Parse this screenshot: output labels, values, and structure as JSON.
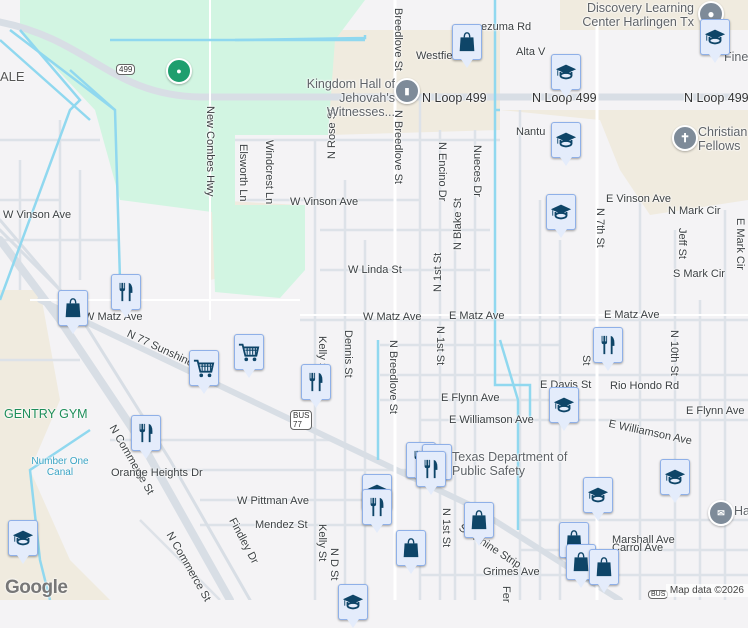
{
  "map": {
    "colors": {
      "background": "#f4f3f5",
      "park": "#d2f5e2",
      "land": "#f0ebdf",
      "road": "#d8dee5",
      "water": "#90d8ef",
      "marker": "#0e4568"
    },
    "roads": {
      "n_loop_499": "N Loop 499",
      "route_499": "499",
      "new_combes_hwy": "New Combes Hwy",
      "breedlove_st": "Breedlove St",
      "n_breedlove_st": "N Breedlove St",
      "n_breedlove_st_2": "N Breedlove St",
      "montezuma_rd": "ezuma Rd",
      "westfield": "Westfie",
      "alta_vista": "Alta V",
      "nantucket": "Nantu",
      "n_rose_st": "N Rose St",
      "elsworth_ln": "Elsworth Ln",
      "windcrest_ln": "Windcrest Ln",
      "n_encino_dr": "N Encino Dr",
      "nueces_dr": "Nueces Dr",
      "n_blake_st": "N Blake St",
      "n_1st_st": "N 1st St",
      "n_1st_st_2": "N 1st St",
      "n_1st_st_3": "N 1st St",
      "w_vinson_ave": "W Vinson Ave",
      "w_vinson_ave_2": "W Vinson Ave",
      "e_vinson_ave": "E Vinson Ave",
      "n_7th_st": "N 7th St",
      "n_7th_st_2": "St",
      "n_mark_cir": "N Mark Cir",
      "s_mark_cir": "S Mark Cir",
      "e_mark_cir": "E Mark Cir",
      "jeff_st": "Jeff St",
      "w_linda_st": "W Linda St",
      "w_matz_ave": "W Matz Ave",
      "w_matz_ave_2": "W Matz Ave",
      "e_matz_ave": "E Matz Ave",
      "e_matz_ave_2": "E Matz Ave",
      "n_77_sunshine": "N 77 Sunshine Strip",
      "sunshine_strip": "Sunshine Strip",
      "kelly_st": "Kelly St",
      "kelly_st_2": "Kelly St",
      "dennis_st": "Dennis St",
      "n_10th_st": "N 10th St",
      "e_davis_st": "E Davis St",
      "rio_hondo_rd": "Rio Hondo Rd",
      "e_flynn_ave": "E Flynn Ave",
      "e_flynn_ave_2": "E Flynn Ave",
      "e_williamson_ave": "E Williamson Ave",
      "e_williamson_ave_2": "E Williamson Ave",
      "n_commerce_st": "N Commerce St",
      "n_commerce_st_2": "N Commerce St",
      "orange_heights_dr": "Orange Heights Dr",
      "w_pittman_ave": "W Pittman Ave",
      "mendez_st": "Mendez St",
      "findley_dr": "Findley Dr",
      "n_d_st": "N D St",
      "marshall_ave": "Marshall Ave",
      "carrol_ave": "Carrol Ave",
      "grimes_ave": "Grimes Ave",
      "fern": "Fer",
      "bus_77_top": "BUS",
      "bus_77_num": "77",
      "bus_bottom": "BUS"
    },
    "places": {
      "discovery": "Discovery Learning Center Harlingen Tx",
      "kingdom_hall": "Kingdom Hall of Jehovah's Witnesses...",
      "christian": "Christian Fellows",
      "dps": "Texas Department of Public Safety",
      "gentry_gym": "GENTRY GYM",
      "number_one_canal": "Number One Canal",
      "area_ale": "ALE",
      "fine": "Fine",
      "h_place": "Ha"
    },
    "marker_types": [
      "school",
      "restaurant",
      "shopping",
      "grocery"
    ],
    "attribution": {
      "logo": "Google",
      "data": "Map data ©2026"
    }
  }
}
